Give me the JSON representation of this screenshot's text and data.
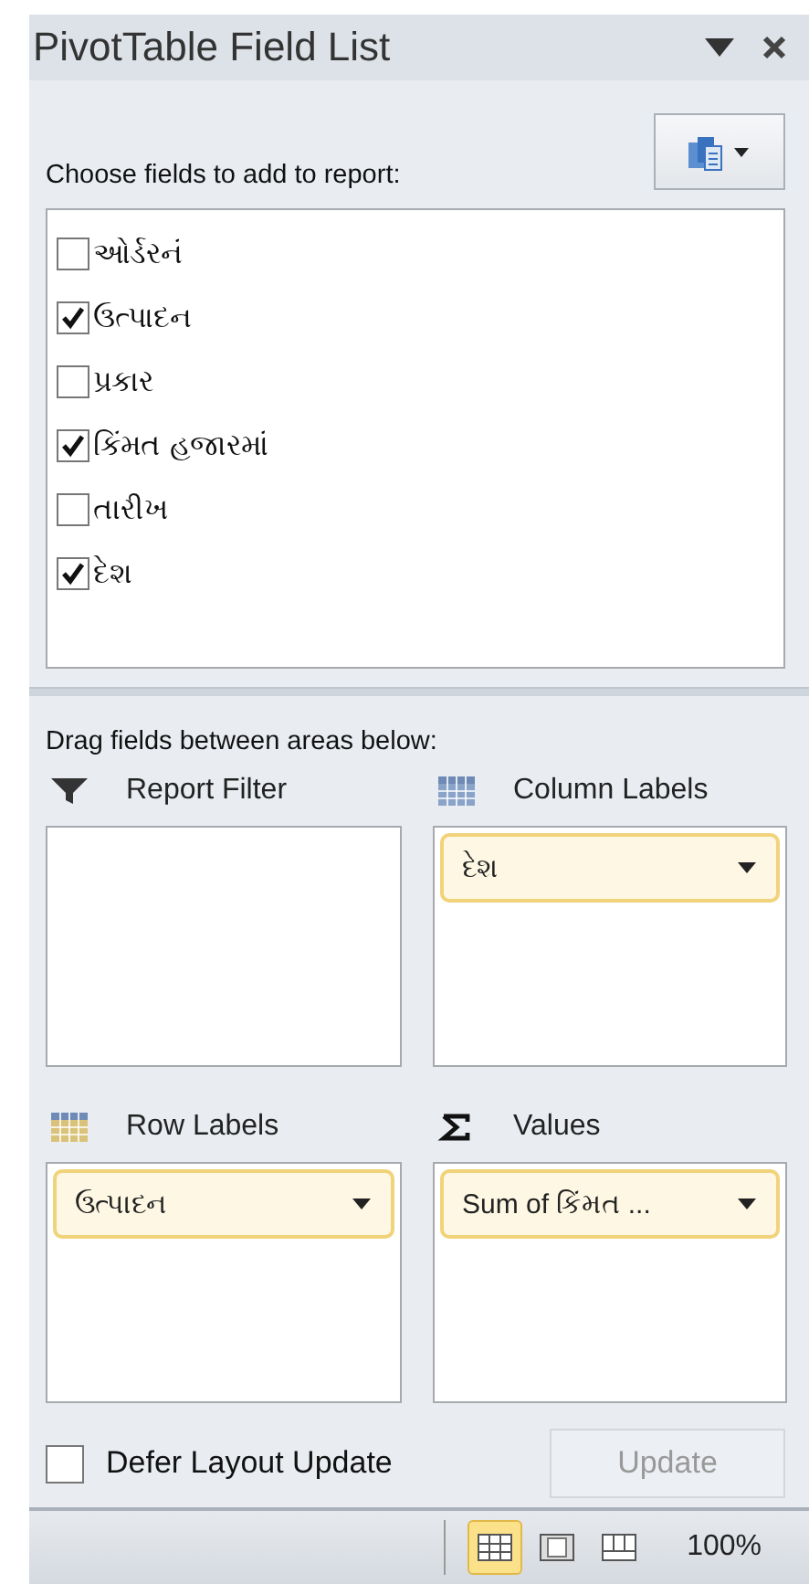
{
  "window": {
    "title": "PivotTable Field List"
  },
  "choose_label": "Choose fields to add to report:",
  "fields": [
    {
      "label": "ઓર્ડરનં",
      "checked": false
    },
    {
      "label": "ઉત્પાદન",
      "checked": true
    },
    {
      "label": "પ્રકાર",
      "checked": false
    },
    {
      "label": "કિંમત હજારમાં",
      "checked": true
    },
    {
      "label": "તારીખ",
      "checked": false
    },
    {
      "label": "દેશ",
      "checked": true
    }
  ],
  "drag_label": "Drag fields between areas below:",
  "areas": [
    {
      "kind": "filter",
      "title": "Report Filter"
    },
    {
      "kind": "columns",
      "title": "Column Labels",
      "items": [
        "દેશ"
      ]
    },
    {
      "kind": "rows",
      "title": "Row Labels",
      "items": [
        "ઉત્પાદન"
      ]
    },
    {
      "kind": "values",
      "title": "Values",
      "items": [
        "Sum of કિંમત ..."
      ]
    }
  ],
  "defer": {
    "label": "Defer Layout Update",
    "checked": false
  },
  "update_button": {
    "label": "Update",
    "disabled": true
  },
  "status_bar": {
    "views": [
      {
        "kind": "normal",
        "selected": true
      },
      {
        "kind": "page_layout",
        "selected": false
      },
      {
        "kind": "page_break",
        "selected": false
      }
    ],
    "zoom": "100%"
  }
}
